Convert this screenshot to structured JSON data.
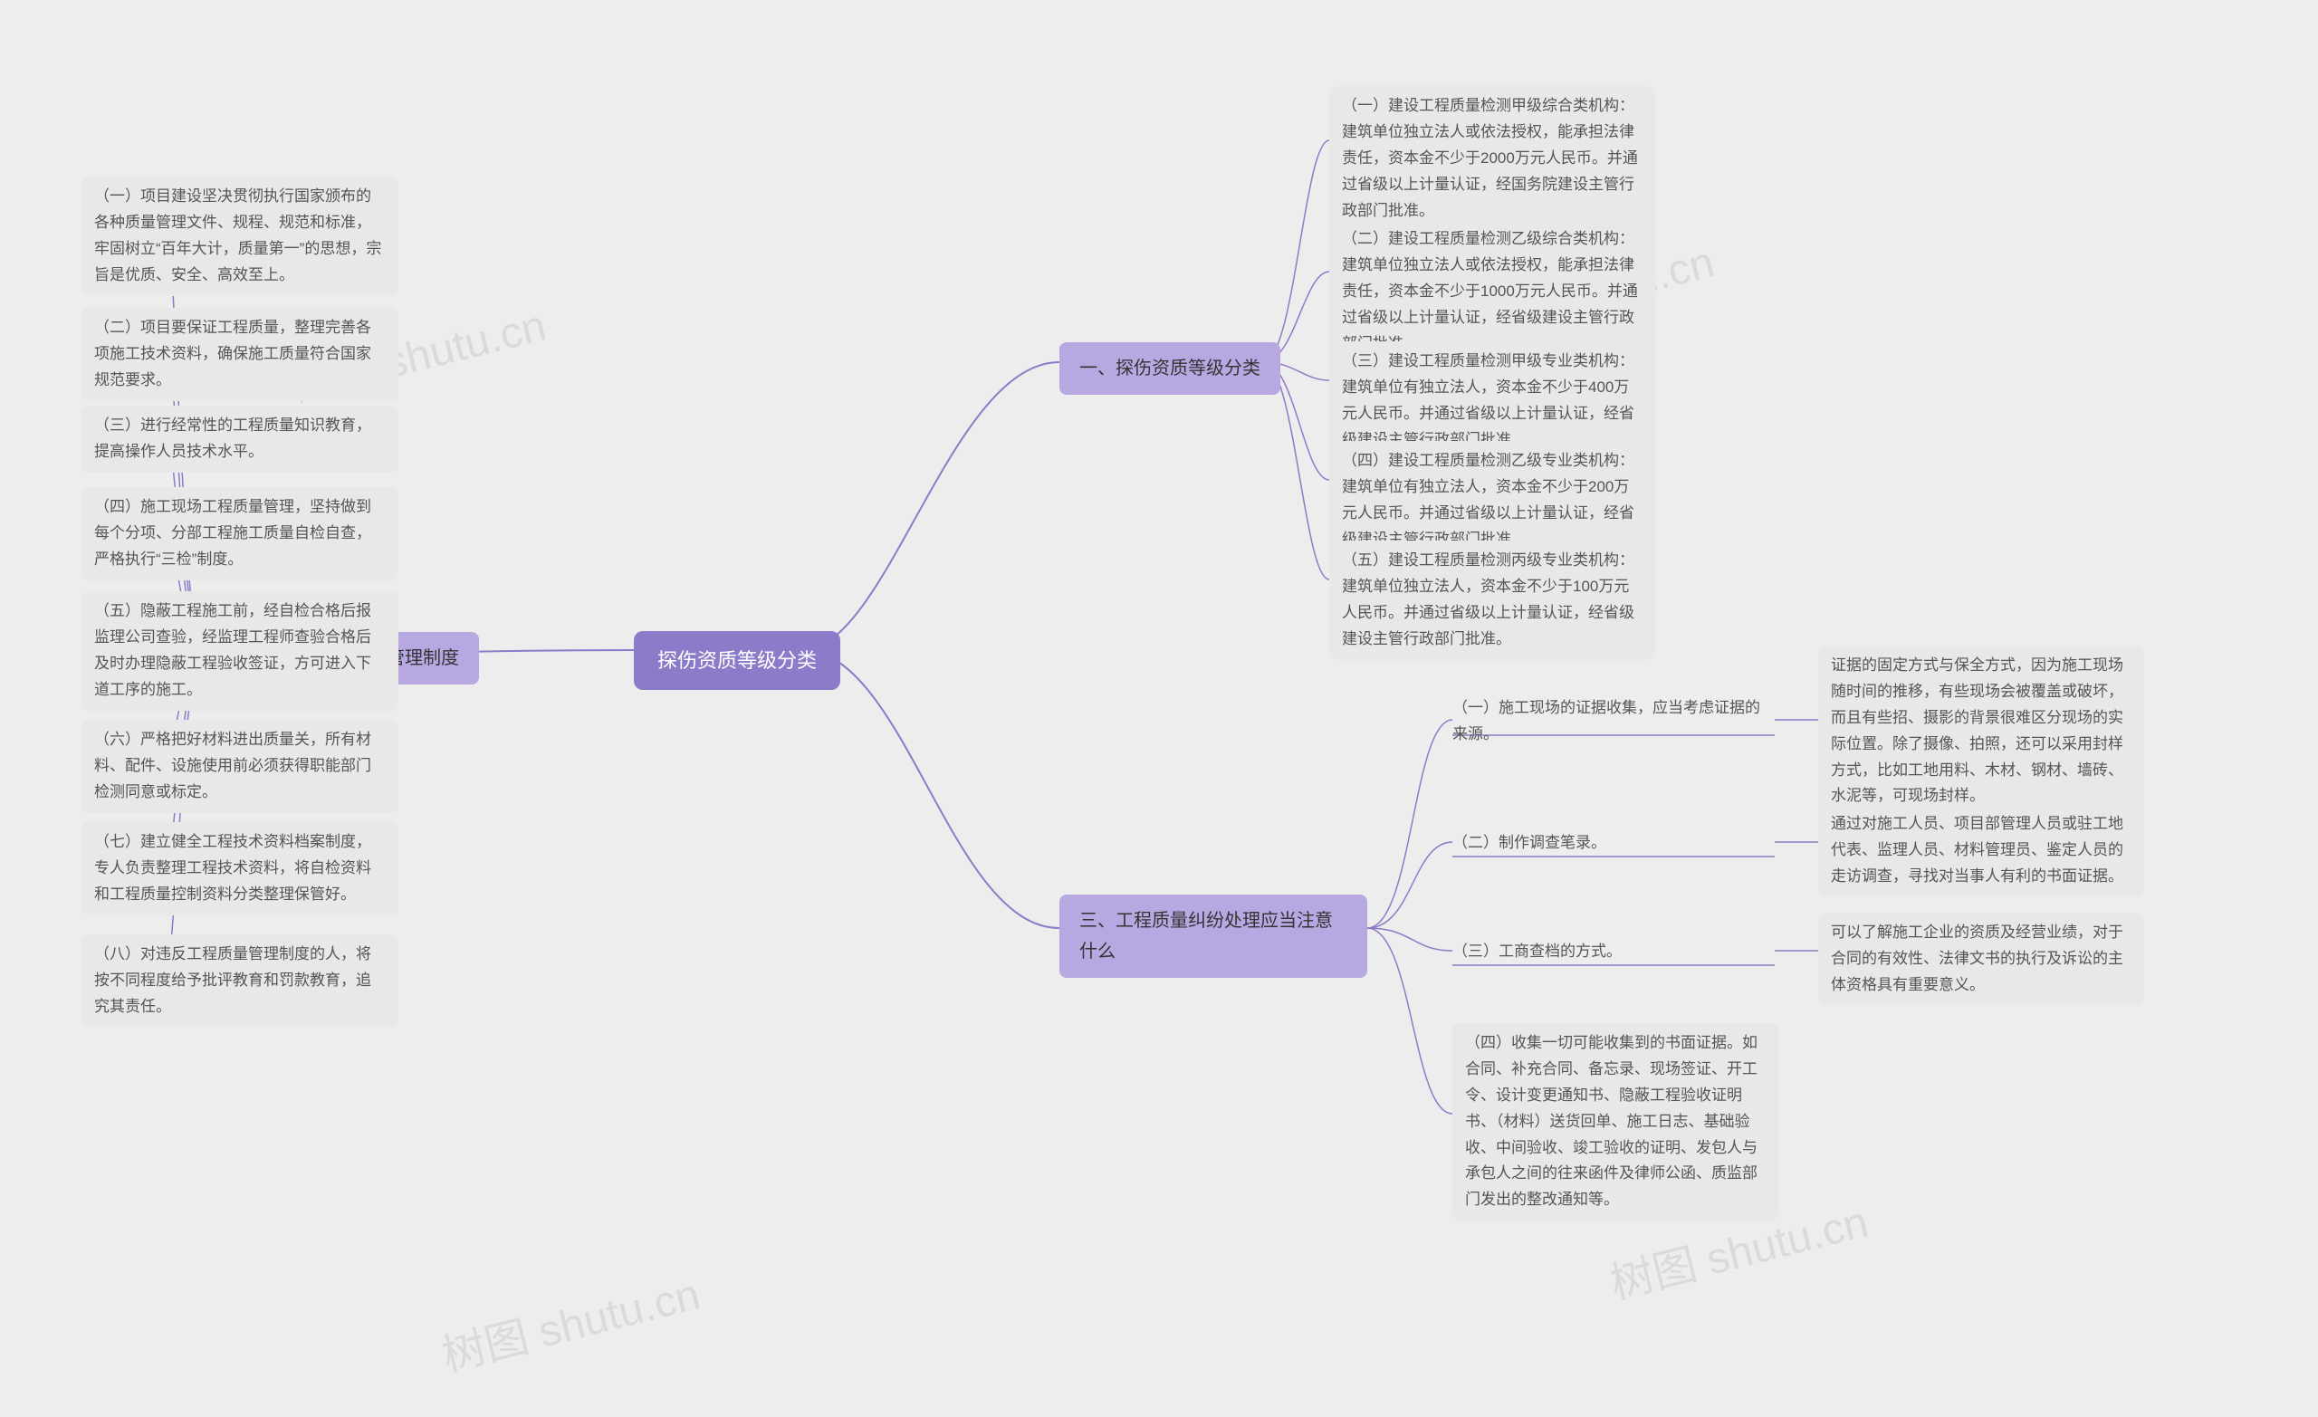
{
  "root": {
    "title": "探伤资质等级分类"
  },
  "branches": {
    "b1": {
      "title": "一、探伤资质等级分类",
      "items": [
        "（一）建设工程质量检测甲级综合类机构：建筑单位独立法人或依法授权，能承担法律责任，资本金不少于2000万元人民币。并通过省级以上计量认证，经国务院建设主管行政部门批准。",
        "（二）建设工程质量检测乙级综合类机构：建筑单位独立法人或依法授权，能承担法律责任，资本金不少于1000万元人民币。并通过省级以上计量认证，经省级建设主管行政部门批准。",
        "（三）建设工程质量检测甲级专业类机构：建筑单位有独立法人，资本金不少于400万元人民币。并通过省级以上计量认证，经省级建设主管行政部门批准。",
        "（四）建设工程质量检测乙级专业类机构：建筑单位有独立法人，资本金不少于200万元人民币。并通过省级以上计量认证，经省级建设主管行政部门批准。",
        "（五）建设工程质量检测丙级专业类机构：建筑单位独立法人，资本金不少于100万元人民币。并通过省级以上计量认证，经省级建设主管行政部门批准。"
      ]
    },
    "b2": {
      "title": "二、工现场工程质量管理制度",
      "items": [
        "（一）项目建设坚决贯彻执行国家颁布的各种质量管理文件、规程、规范和标准，牢固树立“百年大计，质量第一”的思想，宗旨是优质、安全、高效至上。",
        "（二）项目要保证工程质量，整理完善各项施工技术资料，确保施工质量符合国家规范要求。",
        "（三）进行经常性的工程质量知识教育，提高操作人员技术水平。",
        "（四）施工现场工程质量管理，坚持做到每个分项、分部工程施工质量自检自查，严格执行“三检”制度。",
        "（五）隐蔽工程施工前，经自检合格后报监理公司查验，经监理工程师查验合格后及时办理隐蔽工程验收签证，方可进入下道工序的施工。",
        "（六）严格把好材料进出质量关，所有材料、配件、设施使用前必须获得职能部门检测同意或标定。",
        "（七）建立健全工程技术资料档案制度，专人负责整理工程技术资料，将自检资料和工程质量控制资料分类整理保管好。",
        "（八）对违反工程质量管理制度的人，将按不同程度给予批评教育和罚款教育，追究其责任。"
      ]
    },
    "b3": {
      "title": "三、工程质量纠纷处理应当注意什么",
      "items": [
        {
          "label": "（一）施工现场的证据收集，应当考虑证据的来源。",
          "detail": "证据的固定方式与保全方式，因为施工现场随时间的推移，有些现场会被覆盖或破坏，而且有些招、摄影的背景很难区分现场的实际位置。除了摄像、拍照，还可以采用封样方式，比如工地用料、木材、钢材、墙砖、水泥等，可现场封样。"
        },
        {
          "label": "（二）制作调查笔录。",
          "detail": "通过对施工人员、项目部管理人员或驻工地代表、监理人员、材料管理员、鉴定人员的走访调查，寻找对当事人有利的书面证据。"
        },
        {
          "label": "（三）工商查档的方式。",
          "detail": "可以了解施工企业的资质及经营业绩，对于合同的有效性、法律文书的执行及诉讼的主体资格具有重要意义。"
        },
        {
          "label": "（四）收集一切可能收集到的书面证据。如合同、补充合同、备忘录、现场签证、开工令、设计变更通知书、隐蔽工程验收证明书、（材料）送货回单、施工日志、基础验收、中间验收、竣工验收的证明、发包人与承包人之间的往来函件及律师公函、质监部门发出的整改通知等。",
          "detail": ""
        }
      ]
    }
  },
  "watermark": "树图 shutu.cn"
}
